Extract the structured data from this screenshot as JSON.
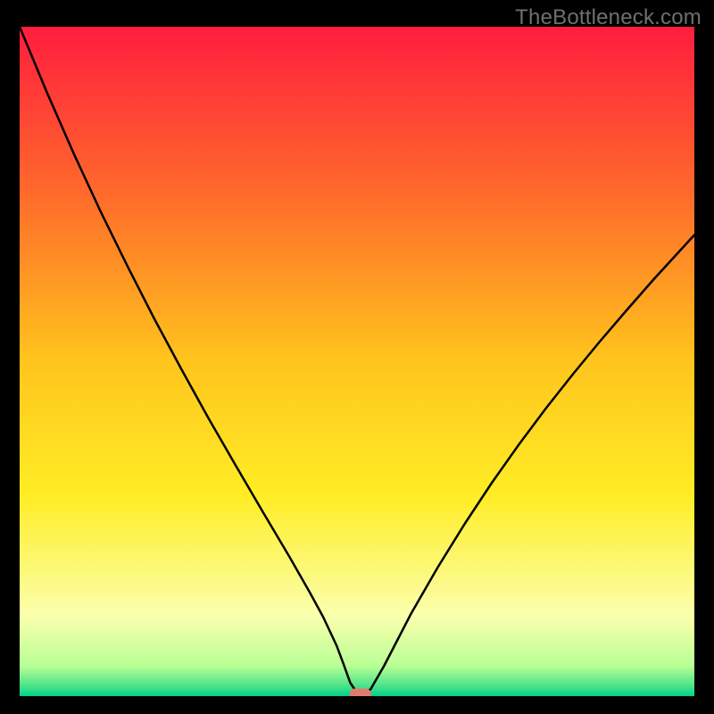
{
  "watermark": "TheBottleneck.com",
  "chart_data": {
    "type": "line",
    "title": "",
    "xlabel": "",
    "ylabel": "",
    "xlim": [
      0,
      100
    ],
    "ylim": [
      0,
      100
    ],
    "grid": false,
    "legend": false,
    "x": [
      0,
      4,
      8,
      12,
      16,
      20,
      24,
      28,
      32,
      36,
      40,
      43,
      45,
      47,
      48,
      49,
      50,
      51,
      52,
      54,
      58,
      62,
      66,
      70,
      74,
      78,
      82,
      86,
      90,
      94,
      98,
      100
    ],
    "values": [
      100,
      90.3,
      81.1,
      72.4,
      64.2,
      56.3,
      48.8,
      41.5,
      34.5,
      27.6,
      20.8,
      15.5,
      11.8,
      7.5,
      4.8,
      2.0,
      0.5,
      0.4,
      1.0,
      4.5,
      12.3,
      19.3,
      25.8,
      31.9,
      37.6,
      43.0,
      48.1,
      53.0,
      57.7,
      62.3,
      66.7,
      68.9
    ],
    "marker": {
      "x": 50.5,
      "y": 0.0
    },
    "background_gradient": {
      "stops": [
        {
          "offset": 0.0,
          "color": "#ff1d3e"
        },
        {
          "offset": 0.25,
          "color": "#ff6a2b"
        },
        {
          "offset": 0.5,
          "color": "#ffc51d"
        },
        {
          "offset": 0.7,
          "color": "#ffed25"
        },
        {
          "offset": 0.88,
          "color": "#fbffad"
        },
        {
          "offset": 0.955,
          "color": "#b8ff95"
        },
        {
          "offset": 0.985,
          "color": "#4be28a"
        },
        {
          "offset": 1.0,
          "color": "#00d08a"
        }
      ]
    }
  }
}
